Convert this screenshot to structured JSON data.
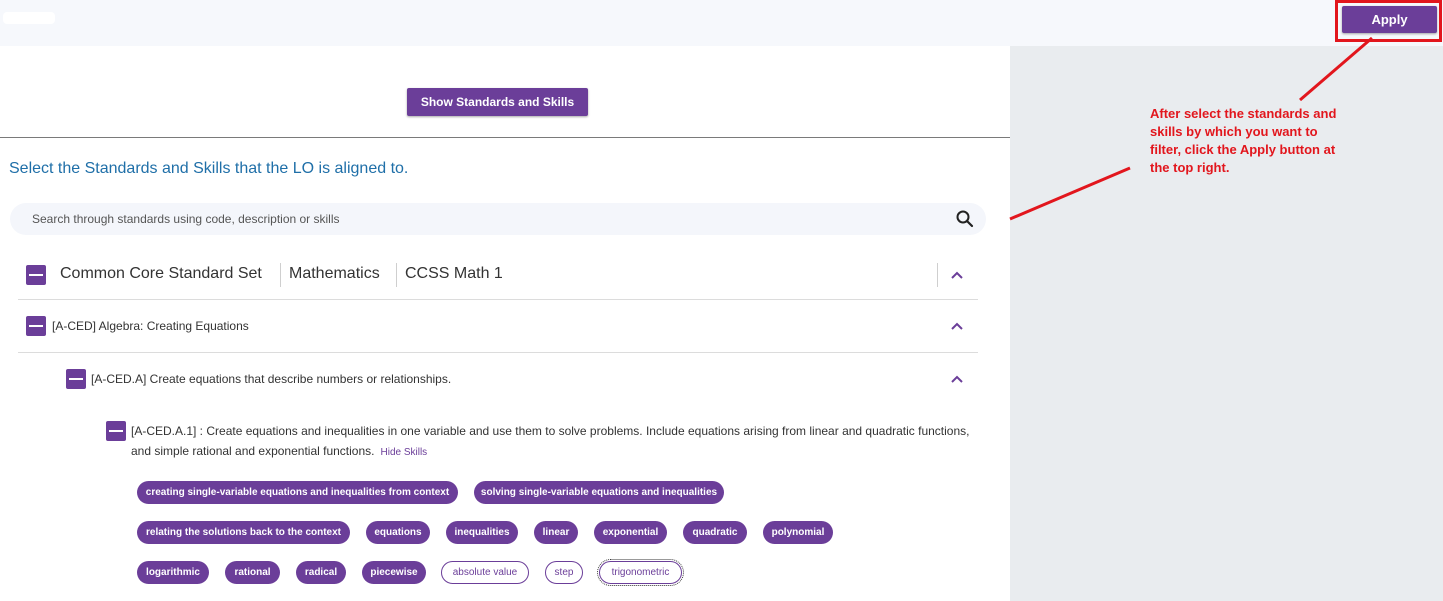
{
  "header": {
    "apply_label": "Apply"
  },
  "main": {
    "show_button_label": "Show Standards and Skills",
    "heading": "Select the Standards and Skills that the LO is aligned to.",
    "search": {
      "placeholder": "Search through standards using code, description or skills"
    },
    "standard_set": {
      "set_name": "Common Core Standard Set",
      "subject": "Mathematics",
      "course": "CCSS Math 1"
    },
    "domain_row": "[A-CED] Algebra: Creating Equations",
    "cluster_row": "[A-CED.A] Create equations that describe numbers or relationships.",
    "standard": {
      "text": "[A-CED.A.1] : Create equations and inequalities in one variable and use them to solve problems. Include equations arising from linear and quadratic functions, and simple rational and exponential functions.",
      "hide_skills_label": "Hide Skills"
    },
    "skills": [
      {
        "label": "creating single-variable equations and inequalities from context",
        "selected": true
      },
      {
        "label": "solving single-variable equations and inequalities",
        "selected": true
      },
      {
        "label": "relating the solutions back to the context",
        "selected": true
      },
      {
        "label": "equations",
        "selected": true
      },
      {
        "label": "inequalities",
        "selected": true
      },
      {
        "label": "linear",
        "selected": true
      },
      {
        "label": "exponential",
        "selected": true
      },
      {
        "label": "quadratic",
        "selected": true
      },
      {
        "label": "polynomial",
        "selected": true
      },
      {
        "label": "logarithmic",
        "selected": true
      },
      {
        "label": "rational",
        "selected": true
      },
      {
        "label": "radical",
        "selected": true
      },
      {
        "label": "piecewise",
        "selected": true
      },
      {
        "label": "absolute value",
        "selected": false
      },
      {
        "label": "step",
        "selected": false
      },
      {
        "label": "trigonometric",
        "selected": false
      }
    ]
  },
  "annotation": {
    "text": "After select the standards and skills by which you want to filter, click the Apply button at the top right."
  },
  "colors": {
    "accent": "#6b3e99",
    "annotation": "#e2161d",
    "heading": "#1f6fa8",
    "panel": "#e9ecef"
  }
}
